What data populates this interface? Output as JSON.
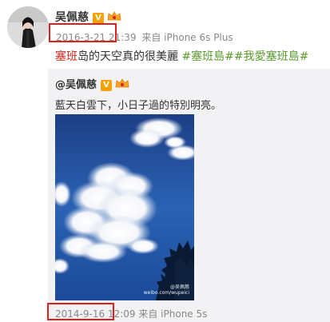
{
  "author": {
    "name": "吴佩慈",
    "verified_badge": "V",
    "badge_icon": "crown-icon"
  },
  "post": {
    "date": "2016-3-21 21:39",
    "source_prefix": "来自",
    "source_device": "iPhone 6s Plus",
    "text_highlight": "塞班",
    "text_rest": "岛的天空真的很美麗",
    "tags": [
      "#塞班島#",
      "#我愛塞班島#"
    ]
  },
  "repost": {
    "author": "@吴佩慈",
    "verified_badge": "V",
    "text": "藍天白雲下，小日子過的特別明亮。",
    "image_watermark_line1": "@吴佩慈",
    "image_watermark_line2": "weibo.com/wupeici",
    "date": "2014-9-16 12:09",
    "source_prefix": "来自",
    "source_device": "iPhone 5s"
  },
  "colors": {
    "highlight_box": "#e02020",
    "tag": "#5a9a2e",
    "red_text": "#e2231a",
    "repost_bg": "#f2f2f5",
    "sky": "#1f4f9e"
  }
}
